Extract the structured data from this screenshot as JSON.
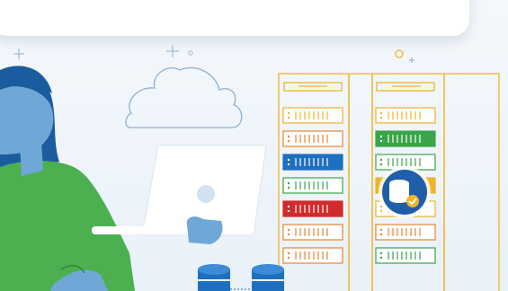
{
  "colors": {
    "background": "#eef4fa",
    "rack_outline": "#f0b429",
    "slot_orange": "#e8852f",
    "slot_green": "#3aa44a",
    "slot_blue": "#1f6fbf",
    "slot_red": "#d12a2a",
    "slot_yellow": "#f0b429",
    "skin": "#6fa8d6",
    "hair": "#1b5c9e",
    "shirt": "#4caf50",
    "laptop": "#ffffff",
    "database": "#1f6fbf",
    "badge": "#1f5ea8",
    "check": "#f0b429"
  },
  "icons": [
    "cloud-icon",
    "plus-icon",
    "database-icon",
    "check-icon"
  ]
}
